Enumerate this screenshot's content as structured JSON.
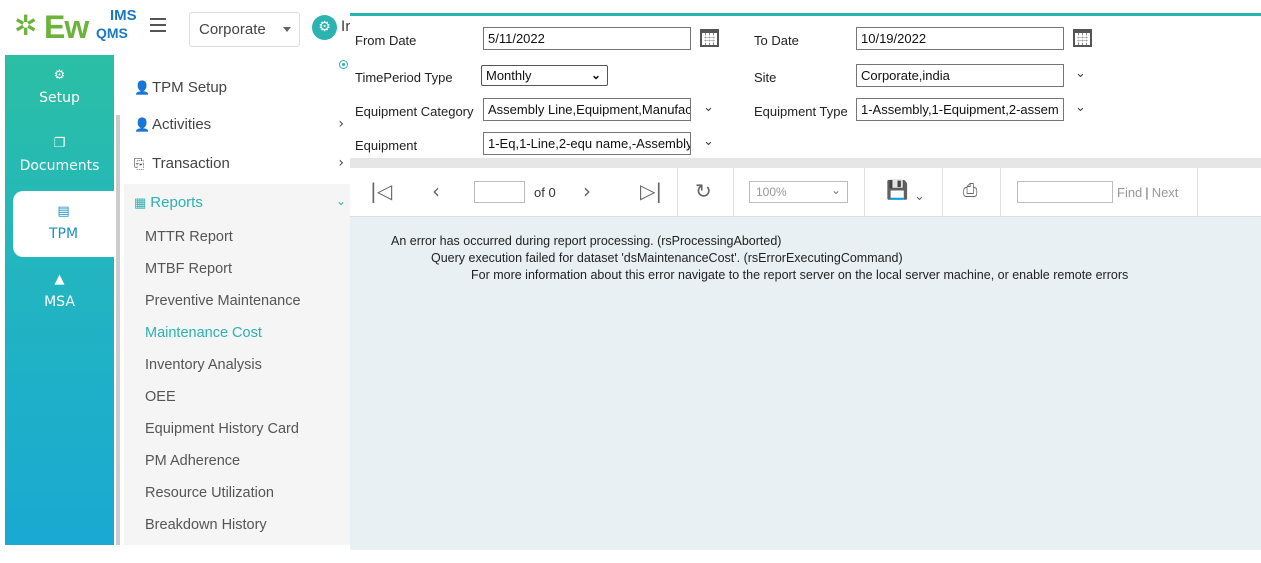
{
  "logo": {
    "brand": "Ew",
    "ims": "IMS",
    "qms": "QMS"
  },
  "header": {
    "org_select": "Corporate",
    "org_label": "In"
  },
  "rail": [
    {
      "label": "Setup",
      "icon": "cogs-icon"
    },
    {
      "label": "Documents",
      "icon": "copy-icon"
    },
    {
      "label": "TPM",
      "icon": "machine-icon"
    },
    {
      "label": "MSA",
      "icon": "chart-icon"
    }
  ],
  "sidebar": {
    "sections": [
      {
        "label": "TPM Setup"
      },
      {
        "label": "Activities"
      },
      {
        "label": "Transaction"
      }
    ],
    "reports": {
      "label": "Reports",
      "items": [
        "MTTR Report",
        "MTBF Report",
        "Preventive Maintenance",
        "Maintenance Cost",
        "Inventory Analysis",
        "OEE",
        "Equipment History Card",
        "PM Adherence",
        "Resource Utilization",
        "Breakdown History"
      ],
      "active_index": 3
    }
  },
  "params": {
    "from_date_label": "From Date",
    "from_date": "5/11/2022",
    "to_date_label": "To Date",
    "to_date": "10/19/2022",
    "timeperiod_label": "TimePeriod Type",
    "timeperiod": "Monthly",
    "site_label": "Site",
    "site": "Corporate,india",
    "eq_category_label": "Equipment Category",
    "eq_category": "Assembly Line,Equipment,Manufac",
    "eq_type_label": "Equipment Type",
    "eq_type": "1-Assembly,1-Equipment,2-assem",
    "equipment_label": "Equipment",
    "equipment": "1-Eq,1-Line,2-equ name,-Assembly"
  },
  "toolbar": {
    "page_of": "of 0",
    "zoom": "100%",
    "find": "Find",
    "next": "Next",
    "pipe": "|"
  },
  "errors": [
    "An error has occurred during report processing. (rsProcessingAborted)",
    "Query execution failed for dataset 'dsMaintenanceCost'. (rsErrorExecutingCommand)",
    "For more information about this error navigate to the report server on the local server machine, or enable remote errors"
  ],
  "colors": {
    "accent": "#2ab3b1",
    "rail_top": "#2bbfa4",
    "rail_bottom": "#19a9d2",
    "logo_green": "#6bb33a",
    "logo_blue": "#1a79c4"
  }
}
